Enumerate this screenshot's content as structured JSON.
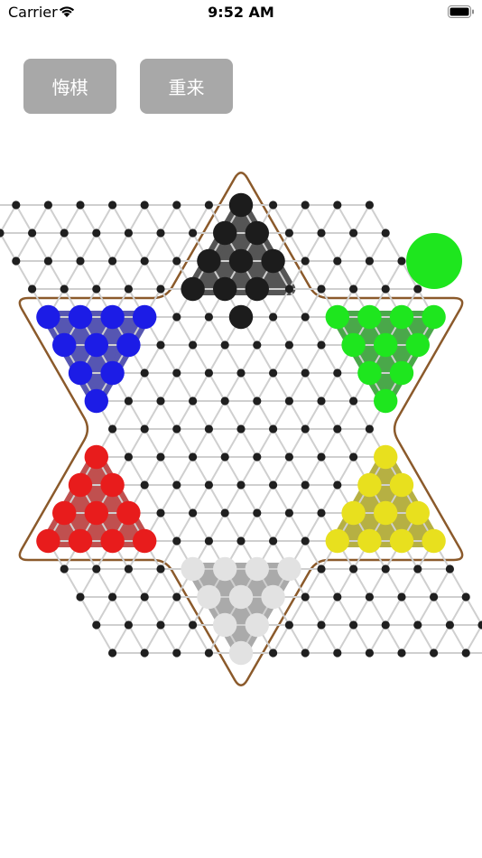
{
  "status_bar": {
    "carrier": "Carrier",
    "time": "9:52 AM"
  },
  "toolbar": {
    "undo_label": "悔棋",
    "restart_label": "重来"
  },
  "game": {
    "current_turn_color": "#1ee61e",
    "board_outline_color": "#8b5a2b",
    "line_color": "#cfcfcf",
    "empty_hole_color": "#1f1f1f",
    "piece_colors": {
      "black": "#1c1c1c",
      "green": "#1ee61e",
      "yellow": "#e8e01e",
      "white": "#e2e2e2",
      "red": "#e81c1c",
      "blue": "#1c1ce6"
    },
    "home_colors": {
      "top": "#555555",
      "upper-right": "#4aa84a",
      "lower-right": "#b6b043",
      "bottom": "#aaaaaa",
      "lower-left": "#c0504f",
      "upper-left": "#5656b2"
    },
    "pieces": [
      {
        "color": "black",
        "r": -8,
        "c": 4
      },
      {
        "color": "black",
        "r": -7,
        "c": 3
      },
      {
        "color": "black",
        "r": -7,
        "c": 4
      },
      {
        "color": "black",
        "r": -6,
        "c": 2
      },
      {
        "color": "black",
        "r": -6,
        "c": 3
      },
      {
        "color": "black",
        "r": -6,
        "c": 4
      },
      {
        "color": "black",
        "r": -5,
        "c": 1
      },
      {
        "color": "black",
        "r": -5,
        "c": 2
      },
      {
        "color": "black",
        "r": -5,
        "c": 3
      },
      {
        "color": "black",
        "r": -4,
        "c": 2
      },
      {
        "color": "blue",
        "r": -4,
        "c": -4
      },
      {
        "color": "blue",
        "r": -4,
        "c": -3
      },
      {
        "color": "blue",
        "r": -4,
        "c": -2
      },
      {
        "color": "blue",
        "r": -4,
        "c": -1
      },
      {
        "color": "blue",
        "r": -3,
        "c": -4
      },
      {
        "color": "blue",
        "r": -3,
        "c": -3
      },
      {
        "color": "blue",
        "r": -3,
        "c": -2
      },
      {
        "color": "blue",
        "r": -2,
        "c": -4
      },
      {
        "color": "blue",
        "r": -2,
        "c": -3
      },
      {
        "color": "blue",
        "r": -1,
        "c": -4
      },
      {
        "color": "green",
        "r": -4,
        "c": 5
      },
      {
        "color": "green",
        "r": -4,
        "c": 6
      },
      {
        "color": "green",
        "r": -4,
        "c": 7
      },
      {
        "color": "green",
        "r": -4,
        "c": 8
      },
      {
        "color": "green",
        "r": -3,
        "c": 5
      },
      {
        "color": "green",
        "r": -3,
        "c": 6
      },
      {
        "color": "green",
        "r": -3,
        "c": 7
      },
      {
        "color": "green",
        "r": -2,
        "c": 5
      },
      {
        "color": "green",
        "r": -2,
        "c": 6
      },
      {
        "color": "green",
        "r": -1,
        "c": 5
      },
      {
        "color": "red",
        "r": 1,
        "c": -5
      },
      {
        "color": "red",
        "r": 2,
        "c": -6
      },
      {
        "color": "red",
        "r": 2,
        "c": -5
      },
      {
        "color": "red",
        "r": 3,
        "c": -7
      },
      {
        "color": "red",
        "r": 3,
        "c": -6
      },
      {
        "color": "red",
        "r": 3,
        "c": -5
      },
      {
        "color": "red",
        "r": 4,
        "c": -8
      },
      {
        "color": "red",
        "r": 4,
        "c": -7
      },
      {
        "color": "red",
        "r": 4,
        "c": -6
      },
      {
        "color": "red",
        "r": 4,
        "c": -5
      },
      {
        "color": "yellow",
        "r": 1,
        "c": 4
      },
      {
        "color": "yellow",
        "r": 2,
        "c": 3
      },
      {
        "color": "yellow",
        "r": 2,
        "c": 4
      },
      {
        "color": "yellow",
        "r": 3,
        "c": 2
      },
      {
        "color": "yellow",
        "r": 3,
        "c": 3
      },
      {
        "color": "yellow",
        "r": 3,
        "c": 4
      },
      {
        "color": "yellow",
        "r": 4,
        "c": 1
      },
      {
        "color": "yellow",
        "r": 4,
        "c": 2
      },
      {
        "color": "yellow",
        "r": 4,
        "c": 3
      },
      {
        "color": "yellow",
        "r": 4,
        "c": 4
      },
      {
        "color": "white",
        "r": 5,
        "c": -4
      },
      {
        "color": "white",
        "r": 5,
        "c": -3
      },
      {
        "color": "white",
        "r": 5,
        "c": -2
      },
      {
        "color": "white",
        "r": 5,
        "c": -1
      },
      {
        "color": "white",
        "r": 6,
        "c": -4
      },
      {
        "color": "white",
        "r": 6,
        "c": -3
      },
      {
        "color": "white",
        "r": 6,
        "c": -2
      },
      {
        "color": "white",
        "r": 7,
        "c": -4
      },
      {
        "color": "white",
        "r": 7,
        "c": -3
      },
      {
        "color": "white",
        "r": 8,
        "c": -4
      }
    ]
  }
}
